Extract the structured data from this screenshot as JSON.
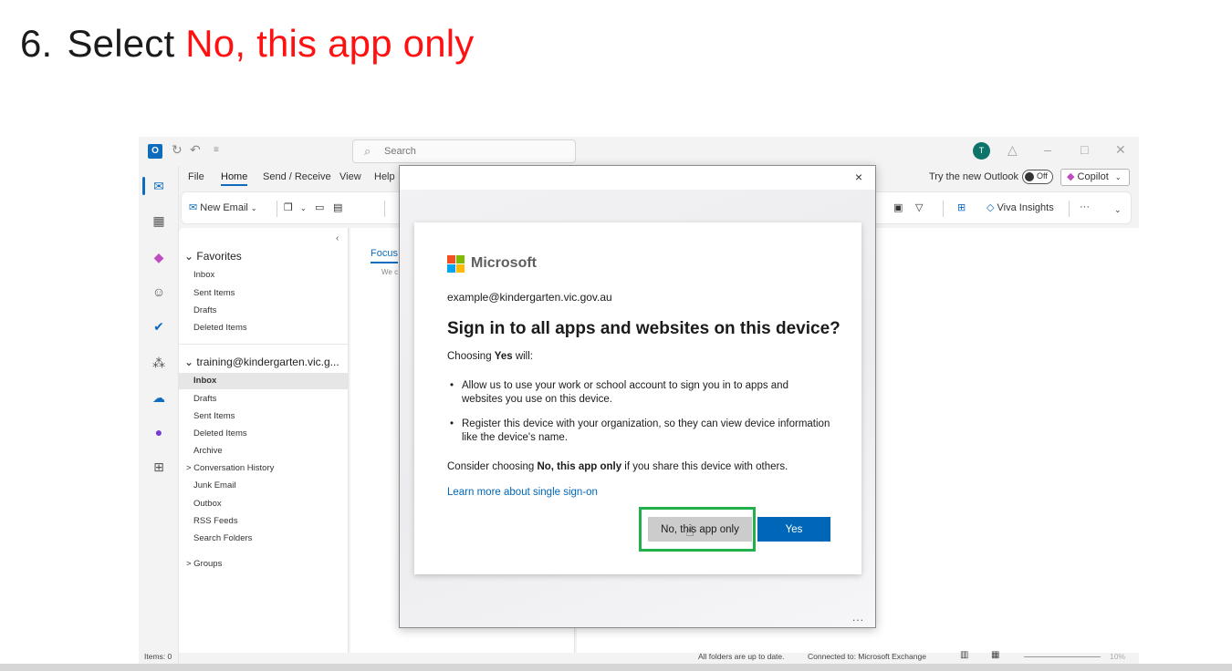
{
  "instruction": {
    "step": "6.",
    "prefix": "Select",
    "highlight": "No, this app only"
  },
  "colors": {
    "highlight": "#ff1111",
    "accent": "#0f6cbd",
    "yes_button": "#0067b8",
    "frame": "#21b04b"
  },
  "search": {
    "placeholder": "Search"
  },
  "avatar": "T",
  "ribbon": {
    "tabs": [
      "File",
      "Home",
      "Send / Receive",
      "View",
      "Help"
    ],
    "active_tab": "Home",
    "new_email": "New Email",
    "viva": "Viva Insights",
    "more": "···"
  },
  "try_new": {
    "label": "Try the new Outlook",
    "toggle": "Off",
    "copilot": "Copilot"
  },
  "folders": {
    "favorites_header": "Favorites",
    "favorites": [
      "Inbox",
      "Sent Items",
      "Drafts",
      "Deleted Items"
    ],
    "account_header": "training@kindergarten.vic.g...",
    "account_folders": [
      "Inbox",
      "Drafts",
      "Sent Items",
      "Deleted Items",
      "Archive",
      "> Conversation History",
      "Junk Email",
      "Outbox",
      "RSS Feeds",
      "Search Folders"
    ],
    "groups": "> Groups"
  },
  "message_list": {
    "tab": "Focus",
    "text": "We c"
  },
  "status": {
    "items": "Items: 0",
    "folders": "All folders are up to date.",
    "connection": "Connected to: Microsoft Exchange",
    "zoom": "10%"
  },
  "dialog": {
    "brand": "Microsoft",
    "account": "example@kindergarten.vic.gov.au",
    "title": "Sign in to all apps and websites on this device?",
    "intro_prefix": "Choosing ",
    "intro_bold": "Yes",
    "intro_suffix": " will:",
    "bullet_1": "Allow us to use your work or school account to sign you in to apps and websites you use on this device.",
    "bullet_2": "Register this device with your organization, so they can view device information like the device's name.",
    "consider_prefix": "Consider choosing ",
    "consider_bold": "No, this app only",
    "consider_suffix": " if you share this device with others.",
    "learn_more": "Learn more about single sign-on",
    "btn_no": "No, this app only",
    "btn_yes": "Yes",
    "close": "×",
    "more": "..."
  }
}
